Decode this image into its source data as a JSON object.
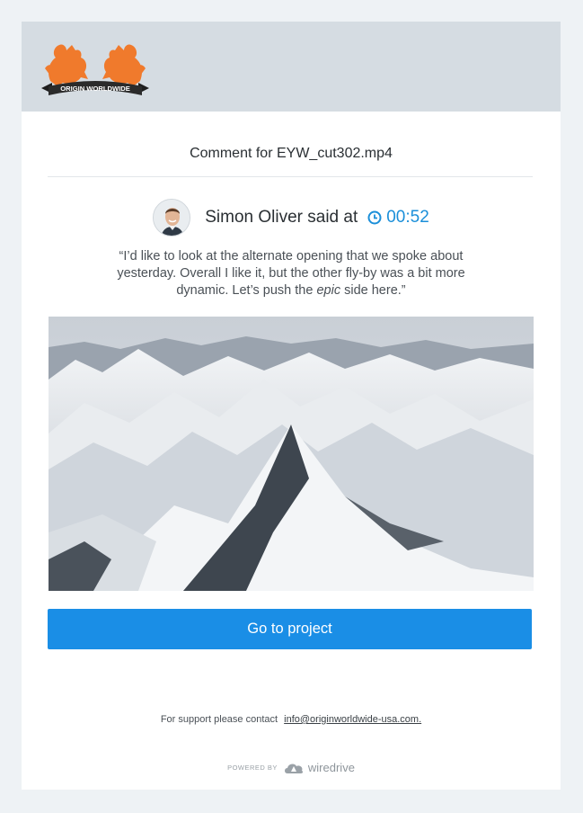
{
  "brand": {
    "logo_text": "ORIGIN WORLDWIDE",
    "colors": {
      "accent": "#f07a2c",
      "banner": "#2b2b2b",
      "header_bg": "#d5dce2",
      "button": "#1a8ee6",
      "timecode": "#1b8fd9"
    }
  },
  "email": {
    "subject": "Comment for EYW_cut302.mp4",
    "commenter": "Simon Oliver said at",
    "timecode": "00:52",
    "quote_before": "“I’d like to look at the alternate opening that we spoke about yesterday.  Overall I like it, but the other fly-by was a bit more dynamic.  Let’s push the ",
    "quote_emph": "epic",
    "quote_after": " side here.”",
    "thumbnail_alt": "snowy mountain range",
    "cta_label": "Go to project"
  },
  "footer": {
    "support_text": "For support please contact",
    "support_email": "info@originworldwide-usa.com.",
    "powered_by": "POWERED BY",
    "provider": "wiredrive"
  }
}
